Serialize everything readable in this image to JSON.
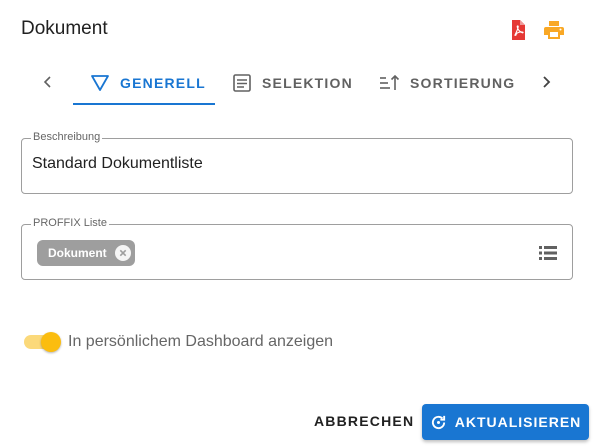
{
  "dialog": {
    "title": "Dokument"
  },
  "header": {
    "pdf_icon": "pdf-icon",
    "print_icon": "printer-icon",
    "pdf_color": "#e53935",
    "print_color": "#f9a825"
  },
  "tabs": [
    {
      "label": "GENERELL",
      "icon": "filter-icon",
      "active": true
    },
    {
      "label": "SELEKTION",
      "icon": "document-list-icon",
      "active": false
    },
    {
      "label": "SORTIERUNG",
      "icon": "sort-icon",
      "active": false
    }
  ],
  "fields": {
    "beschreibung": {
      "label": "Beschreibung",
      "value": "Standard Dokumentliste"
    },
    "proffix_liste": {
      "label": "PROFFIX Liste",
      "chip": "Dokument",
      "list_icon": "list-icon"
    }
  },
  "toggle": {
    "label": "In persönlichem Dashboard anzeigen",
    "on": true,
    "color": "#fbbd0f"
  },
  "actions": {
    "cancel": "ABBRECHEN",
    "submit": "AKTUALISIEREN",
    "submit_icon": "refresh-icon",
    "primary_color": "#1976d2"
  }
}
